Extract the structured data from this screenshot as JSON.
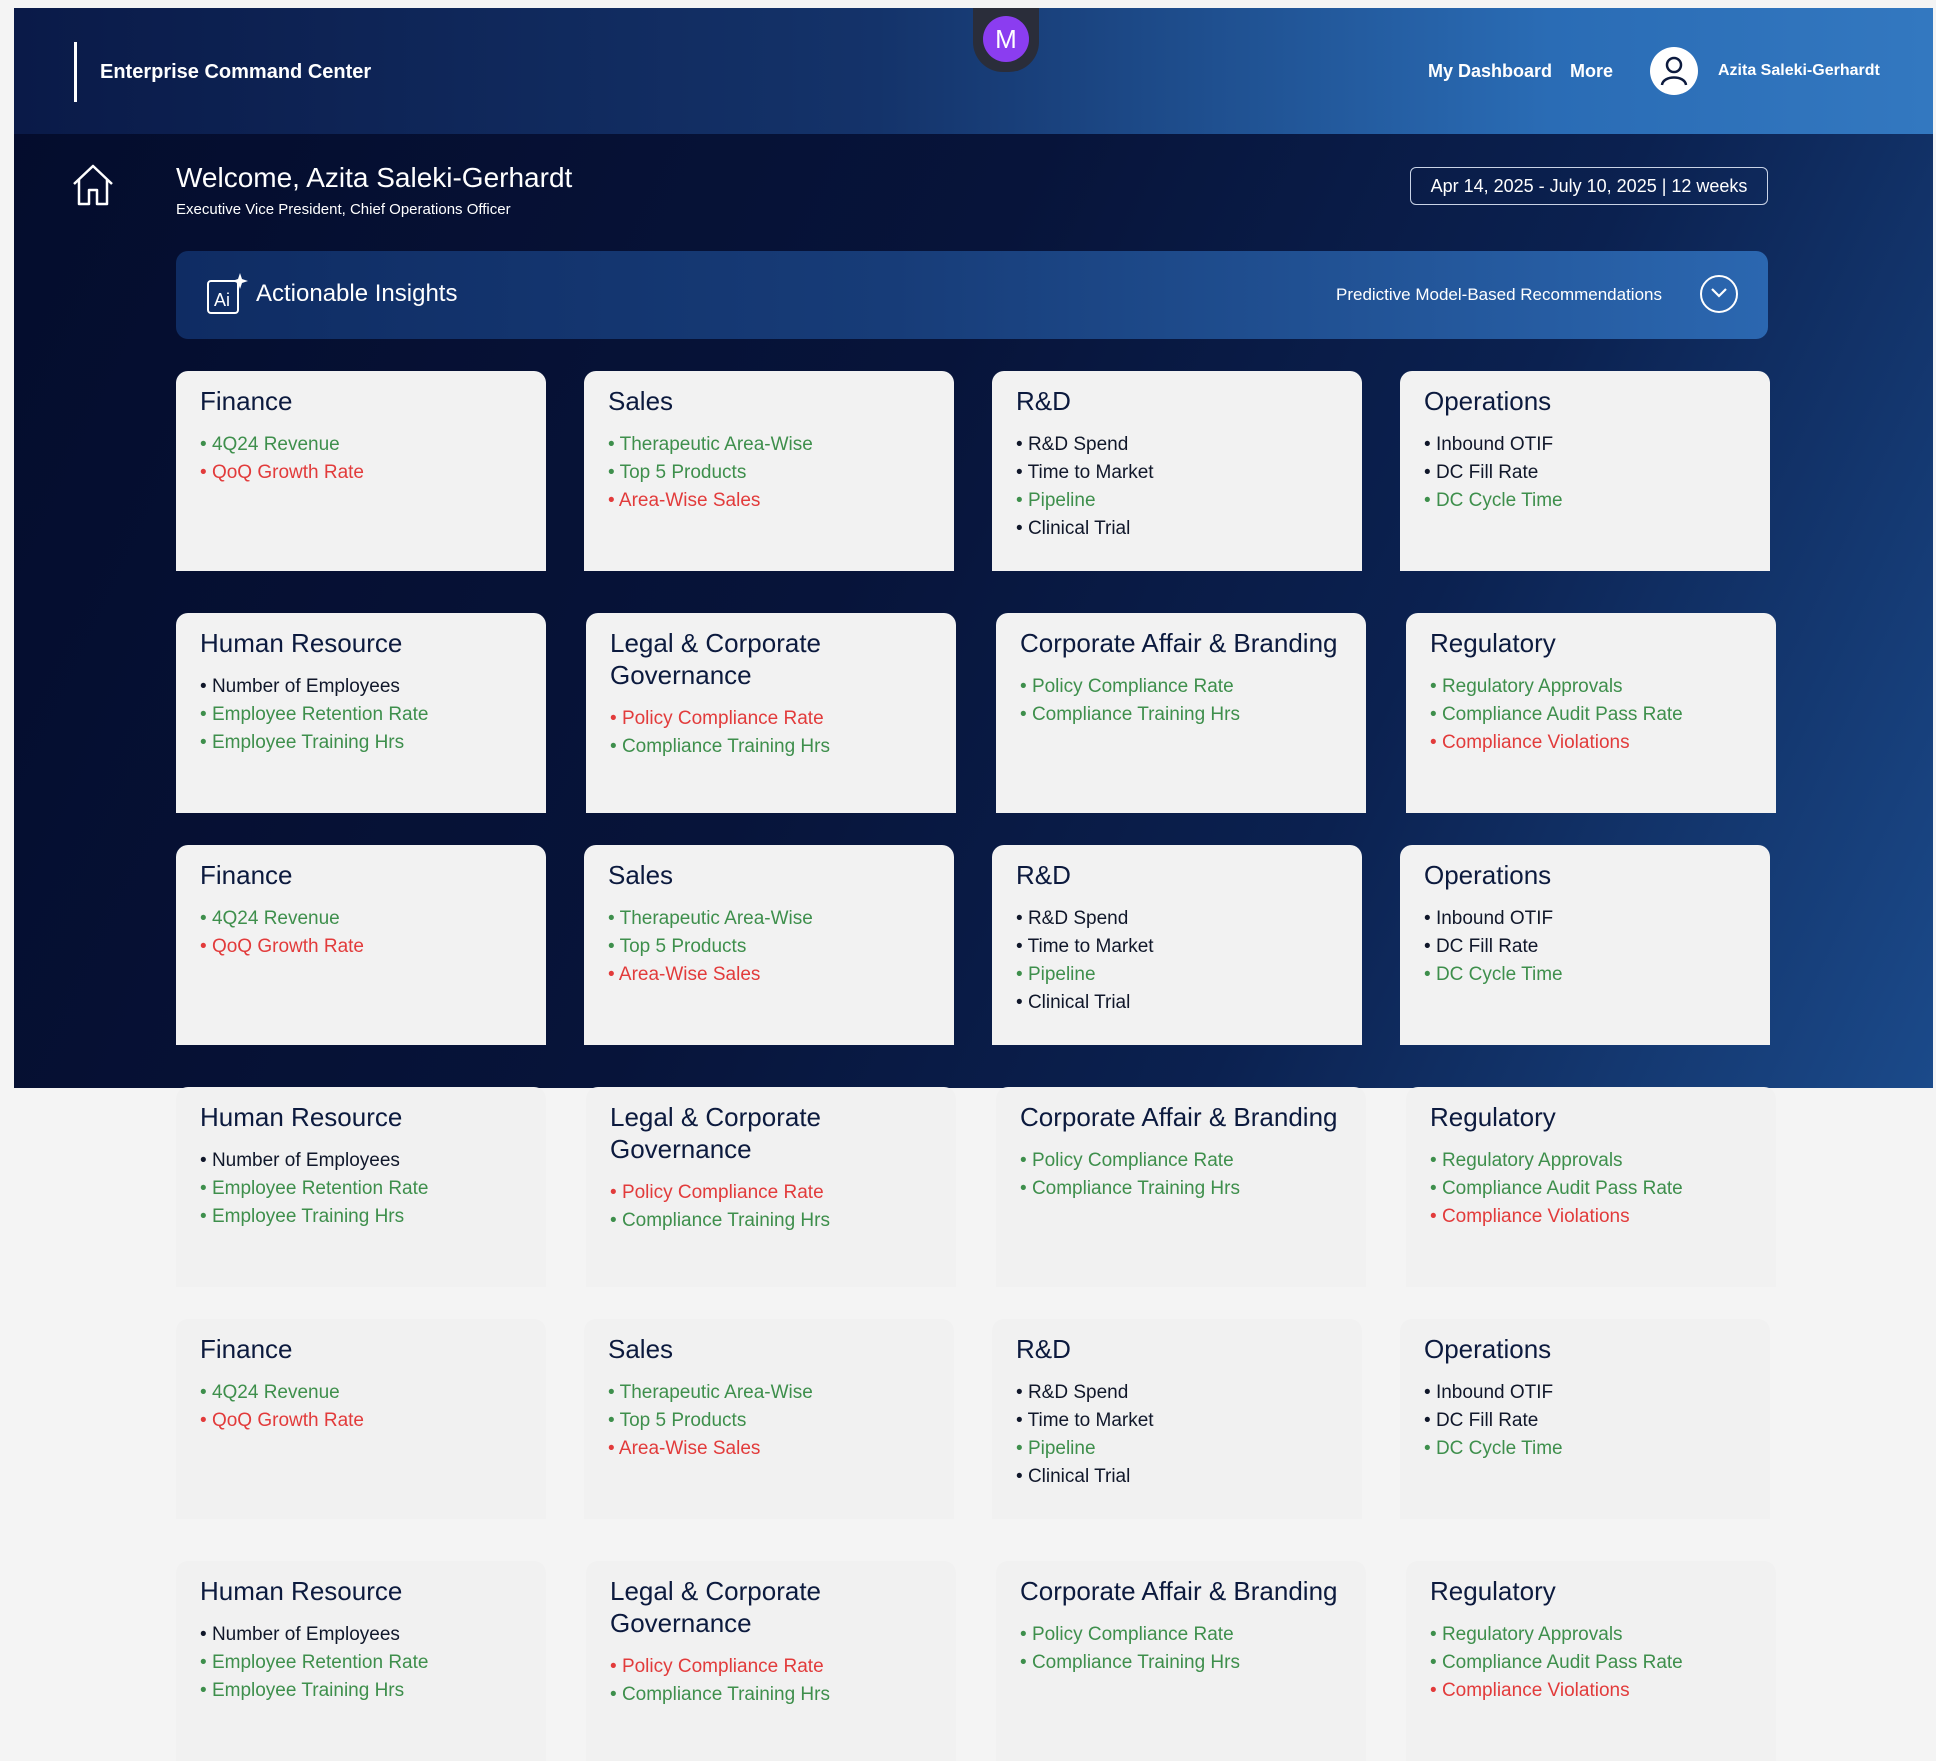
{
  "header": {
    "app_title": "Enterprise Command Center",
    "badge_letter": "M",
    "nav": [
      "My Dashboard",
      "More"
    ],
    "user_name": "Azita Saleki-Gerhardt"
  },
  "welcome": {
    "title": "Welcome, Azita Saleki-Gerhardt",
    "subtitle": "Executive Vice President, Chief Operations Officer",
    "date_range": "Apr 14, 2025 - July 10, 2025 | 12 weeks"
  },
  "insights": {
    "title": "Actionable Insights",
    "subtitle": "Predictive Model-Based Recommendations"
  },
  "colors": {
    "positive": "#3e8f4c",
    "negative": "#e23b3b",
    "neutral": "#10172a"
  },
  "card_sets": {
    "set_a": [
      {
        "title": "Finance",
        "items": [
          {
            "label": "4Q24 Revenue",
            "status": "green"
          },
          {
            "label": "QoQ Growth Rate",
            "status": "red"
          }
        ]
      },
      {
        "title": "Sales",
        "items": [
          {
            "label": "Therapeutic Area-Wise",
            "status": "green"
          },
          {
            "label": "Top 5 Products",
            "status": "green"
          },
          {
            "label": "Area-Wise Sales",
            "status": "red"
          }
        ]
      },
      {
        "title": "R&D",
        "items": [
          {
            "label": "R&D Spend",
            "status": "dark"
          },
          {
            "label": "Time to Market",
            "status": "dark"
          },
          {
            "label": "Pipeline",
            "status": "green"
          },
          {
            "label": "Clinical Trial",
            "status": "dark"
          }
        ]
      },
      {
        "title": "Operations",
        "items": [
          {
            "label": "Inbound OTIF",
            "status": "dark"
          },
          {
            "label": "DC Fill Rate",
            "status": "dark"
          },
          {
            "label": "DC Cycle Time",
            "status": "green"
          }
        ]
      }
    ],
    "set_b": [
      {
        "title": "Human Resource",
        "items": [
          {
            "label": "Number of Employees",
            "status": "dark"
          },
          {
            "label": "Employee Retention Rate",
            "status": "green"
          },
          {
            "label": "Employee Training Hrs",
            "status": "green"
          }
        ]
      },
      {
        "title": "Legal & Corporate Governance",
        "items": [
          {
            "label": "Policy Compliance Rate",
            "status": "red"
          },
          {
            "label": "Compliance Training Hrs",
            "status": "green"
          }
        ]
      },
      {
        "title": "Corporate Affair & Branding",
        "items": [
          {
            "label": "Policy Compliance Rate",
            "status": "green"
          },
          {
            "label": "Compliance Training Hrs",
            "status": "green"
          }
        ]
      },
      {
        "title": "Regulatory",
        "items": [
          {
            "label": "Regulatory Approvals",
            "status": "green"
          },
          {
            "label": "Compliance Audit Pass Rate",
            "status": "green"
          },
          {
            "label": "Compliance Violations",
            "status": "red"
          }
        ]
      }
    ]
  }
}
